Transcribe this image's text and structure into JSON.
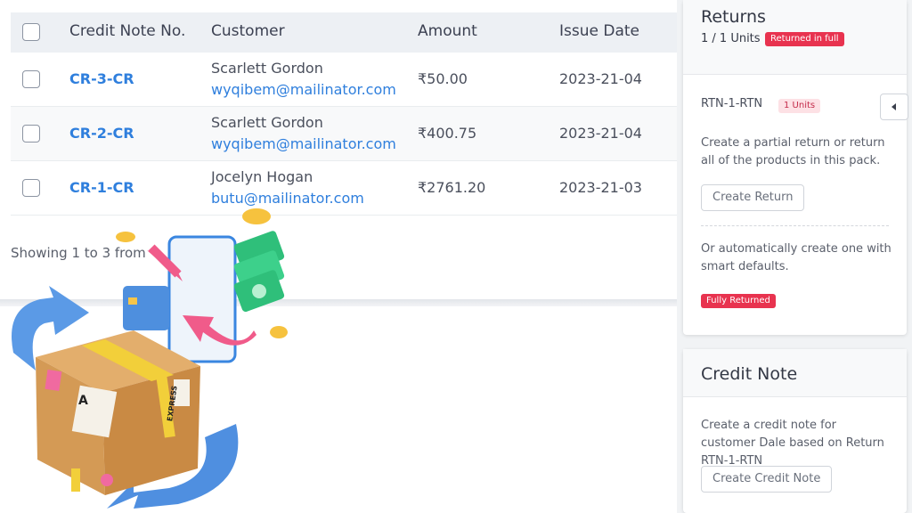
{
  "table": {
    "headers": {
      "credit_note_no": "Credit Note No.",
      "customer": "Customer",
      "amount": "Amount",
      "issue_date": "Issue Date"
    },
    "rows": [
      {
        "credit_note_no": "CR-3-CR",
        "customer_name": "Scarlett Gordon",
        "customer_email": "wyqibem@mailinator.com",
        "amount": "₹50.00",
        "issue_date": "2023-21-04"
      },
      {
        "credit_note_no": "CR-2-CR",
        "customer_name": "Scarlett Gordon",
        "customer_email": "wyqibem@mailinator.com",
        "amount": "₹400.75",
        "issue_date": "2023-21-04"
      },
      {
        "credit_note_no": "CR-1-CR",
        "customer_name": "Jocelyn Hogan",
        "customer_email": "butu@mailinator.com",
        "amount": "₹2761.20",
        "issue_date": "2023-21-03"
      }
    ],
    "showing_text": "Showing 1 to 3 from"
  },
  "returns_card": {
    "title": "Returns",
    "units": "1 / 1 Units",
    "status_badge": "Returned in full",
    "return_id": "RTN-1-RTN",
    "return_units_badge": "1 Units",
    "partial_text": "Create a partial return or return all of the products in this pack.",
    "create_return_button": "Create Return",
    "auto_text": "Or automatically create one with smart defaults.",
    "fully_returned_badge": "Fully Returned"
  },
  "credit_note_card": {
    "title": "Credit Note",
    "description": "Create a credit note for customer Dale based on Return RTN-1-RTN",
    "create_button": "Create Credit Note"
  },
  "illustration": {
    "box_letter": "A",
    "tape_text": "EXPRESS",
    "icon": "package-return-illustration"
  },
  "colors": {
    "link_blue": "#2f7fdd",
    "badge_red": "#e8334f",
    "header_bg": "#edf0f4"
  }
}
